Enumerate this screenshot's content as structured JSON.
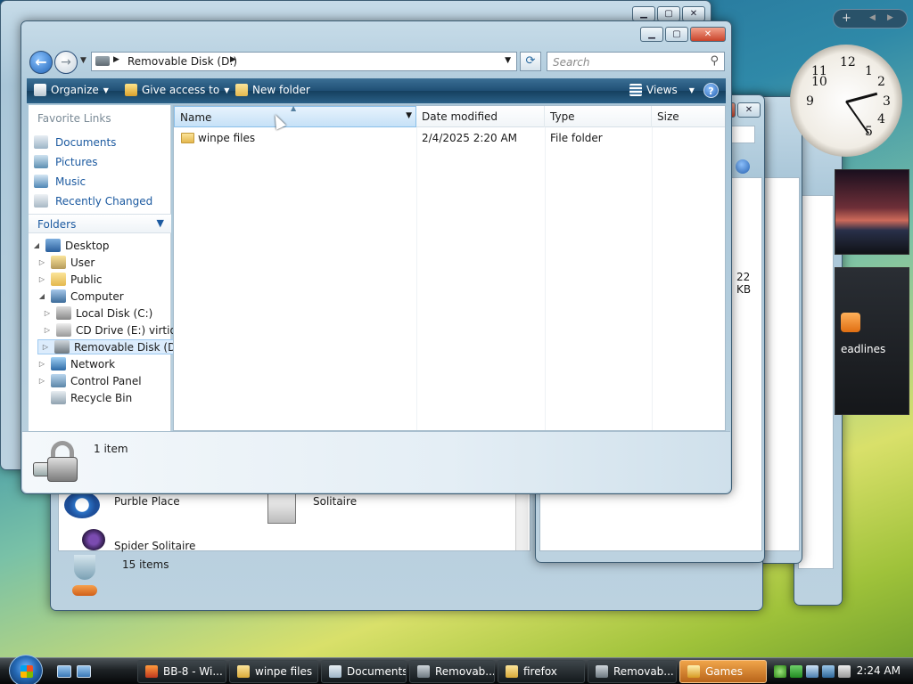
{
  "colors": {
    "accent": "#1c5aa0",
    "glass": "#1f4f74",
    "selection": "#dcecfc",
    "active_task": "#f0a54a"
  },
  "main_window": {
    "address": {
      "path": "Removable Disk (D:)",
      "search_placeholder": "Search"
    },
    "toolbar": {
      "organize": "Organize",
      "give_access": "Give access to",
      "new_folder": "New folder",
      "views": "Views",
      "help": "?"
    },
    "favorites": {
      "header": "Favorite Links",
      "items": [
        {
          "label": "Documents",
          "icon": "documents-icon"
        },
        {
          "label": "Pictures",
          "icon": "pictures-icon"
        },
        {
          "label": "Music",
          "icon": "music-icon"
        },
        {
          "label": "Recently Changed",
          "icon": "recent-icon"
        }
      ]
    },
    "folders_label": "Folders",
    "tree": [
      {
        "label": "Desktop",
        "expander": "◢",
        "icon": "desktop-icon"
      },
      {
        "label": "User",
        "expander": "▷",
        "icon": "user-folder-icon"
      },
      {
        "label": "Public",
        "expander": "▷",
        "icon": "public-folder-icon"
      },
      {
        "label": "Computer",
        "expander": "◢",
        "icon": "computer-icon"
      },
      {
        "label": "Local Disk (C:)",
        "expander": "▷",
        "icon": "hard-disk-icon"
      },
      {
        "label": "CD Drive (E:) virtio-w",
        "expander": "▷",
        "icon": "cd-drive-icon"
      },
      {
        "label": "Removable Disk (D:)",
        "expander": "▷",
        "icon": "removable-disk-icon",
        "selected": true
      },
      {
        "label": "Network",
        "expander": "▷",
        "icon": "network-icon"
      },
      {
        "label": "Control Panel",
        "expander": "▷",
        "icon": "control-panel-icon"
      },
      {
        "label": "Recycle Bin",
        "expander": "",
        "icon": "recycle-bin-icon"
      }
    ],
    "columns": {
      "name": "Name",
      "date": "Date modified",
      "type": "Type",
      "size": "Size"
    },
    "files": [
      {
        "name": "winpe files",
        "date": "2/4/2025 2:20 AM",
        "type": "File folder",
        "size": ""
      }
    ],
    "details": {
      "item_count": "1 item"
    }
  },
  "background_windows": {
    "games": {
      "items": [
        "Purble Place",
        "Solitaire",
        "Spider Solitaire"
      ],
      "item_count": "15 items"
    },
    "peek": {
      "size_text": "22 KB",
      "partial_text": "B"
    }
  },
  "gadgets": {
    "feed_label": "eadlines",
    "sidebar_add": "+"
  },
  "taskbar": {
    "tasks": [
      {
        "label": "BB-8 - Wi..."
      },
      {
        "label": "winpe files"
      },
      {
        "label": "Documents"
      },
      {
        "label": "Removab..."
      },
      {
        "label": "firefox"
      },
      {
        "label": "Removab..."
      },
      {
        "label": "Games",
        "active": true
      }
    ],
    "clock": "2:24 AM"
  }
}
